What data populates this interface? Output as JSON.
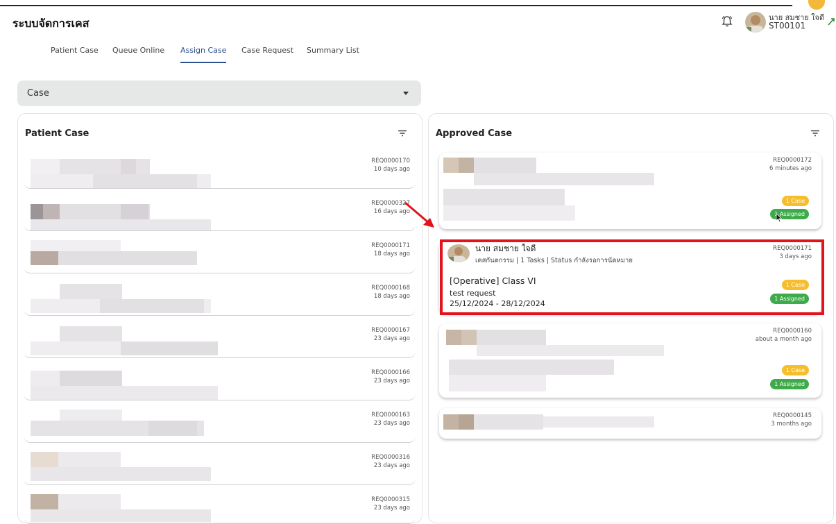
{
  "app": {
    "title": "ระบบจัดการเคส"
  },
  "user": {
    "name": "นาย สมชาย ใจดี",
    "id": "ST00101"
  },
  "nav": {
    "tabs": [
      {
        "label": "Patient Case",
        "active": false
      },
      {
        "label": "Queue Online",
        "active": false
      },
      {
        "label": "Assign Case",
        "active": true
      },
      {
        "label": "Case Request",
        "active": false
      },
      {
        "label": "Summary List",
        "active": false
      }
    ]
  },
  "case_select": {
    "value": "Case"
  },
  "patient_panel": {
    "title": "Patient Case",
    "items": [
      {
        "req": "REQ0000170",
        "ago": "10 days ago"
      },
      {
        "req": "REQ0000327",
        "ago": "16 days ago"
      },
      {
        "req": "REQ0000171",
        "ago": "18 days ago"
      },
      {
        "req": "REQ0000168",
        "ago": "18 days ago"
      },
      {
        "req": "REQ0000167",
        "ago": "23 days ago"
      },
      {
        "req": "REQ0000166",
        "ago": "23 days ago"
      },
      {
        "req": "REQ0000163",
        "ago": "23 days ago"
      },
      {
        "req": "REQ0000316",
        "ago": "23 days ago"
      },
      {
        "req": "REQ0000315",
        "ago": "23 days ago"
      }
    ]
  },
  "approved_panel": {
    "title": "Approved Case",
    "cards": [
      {
        "req": "REQ0000172",
        "ago": "6 minutes ago",
        "case_badge": "1 Case",
        "assigned_badge": "1 Assigned"
      },
      {
        "req": "REQ0000171",
        "ago": "3 days ago",
        "name": "นาย สมชาย ใจดี",
        "subtitle": "เคสกันตกรรม | 1 Tasks | Status กำลังรอการนัดหมาย",
        "title": "[Operative] Class VI",
        "description": "test request",
        "date_range": "25/12/2024 - 28/12/2024",
        "case_badge": "1 Case",
        "assigned_badge": "1 Assigned"
      },
      {
        "req": "REQ0000160",
        "ago": "about a month ago",
        "case_badge": "1 Case",
        "assigned_badge": "1 Assigned"
      },
      {
        "req": "REQ0000145",
        "ago": "3 months ago"
      }
    ]
  },
  "colors": {
    "accent": "#2a4f8e",
    "highlight": "#e3131b",
    "badge_orange": "#f7be2c",
    "badge_green": "#3eaa4a"
  },
  "icons": [
    "bell-icon",
    "avatar",
    "expand-icon",
    "filter-icon",
    "chevron-down-icon",
    "arrow-annotation",
    "mouse-cursor-icon"
  ]
}
